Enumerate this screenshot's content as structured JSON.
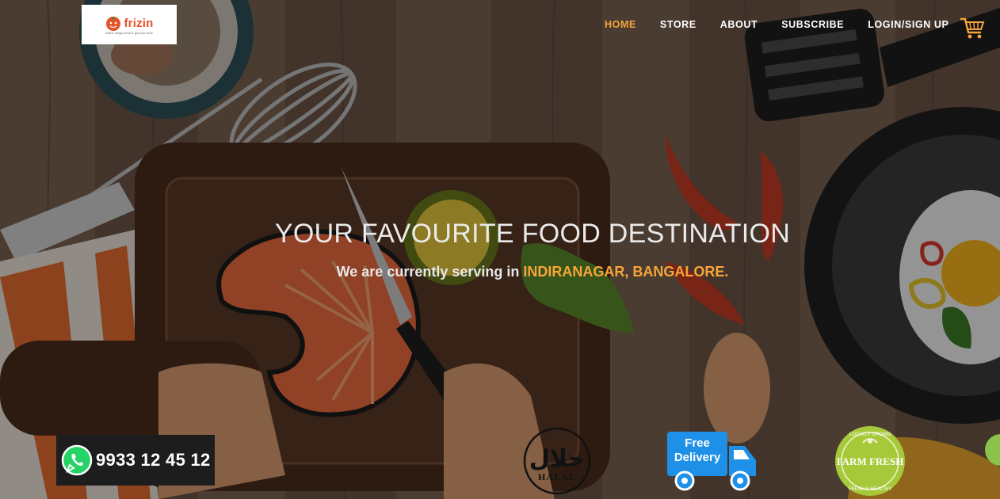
{
  "header": {
    "logo_text": "frizin",
    "logo_tagline": "online mega meat & grocery store",
    "nav": [
      {
        "label": "HOME",
        "active": true
      },
      {
        "label": "STORE",
        "active": false
      },
      {
        "label": "ABOUT",
        "active": false
      },
      {
        "label": "SUBSCRIBE",
        "active": false
      },
      {
        "label": "LOGIN/SIGN UP",
        "active": false
      }
    ],
    "cart_icon": "shopping-cart-icon"
  },
  "hero": {
    "headline": "YOUR FAVOURITE FOOD DESTINATION",
    "sub_prefix": "We are currently serving in ",
    "sub_location": "INDIRANAGAR, BANGALORE."
  },
  "contact": {
    "whatsapp_icon": "whatsapp-icon",
    "phone": "9933 12 45 12"
  },
  "badges": {
    "halal_arabic": "حلال",
    "halal_label": "HALAL",
    "delivery_line1": "Free",
    "delivery_line2": "Delivery",
    "farm_main": "FARM FRESH",
    "farm_top": "LOCALLY GROWN",
    "farm_bottom": "FRESH & HEALTHY"
  },
  "colors": {
    "accent": "#f7a539",
    "nav_text": "#ffffff",
    "delivery_blue": "#1e90e8",
    "farm_green": "#a6c93a"
  }
}
